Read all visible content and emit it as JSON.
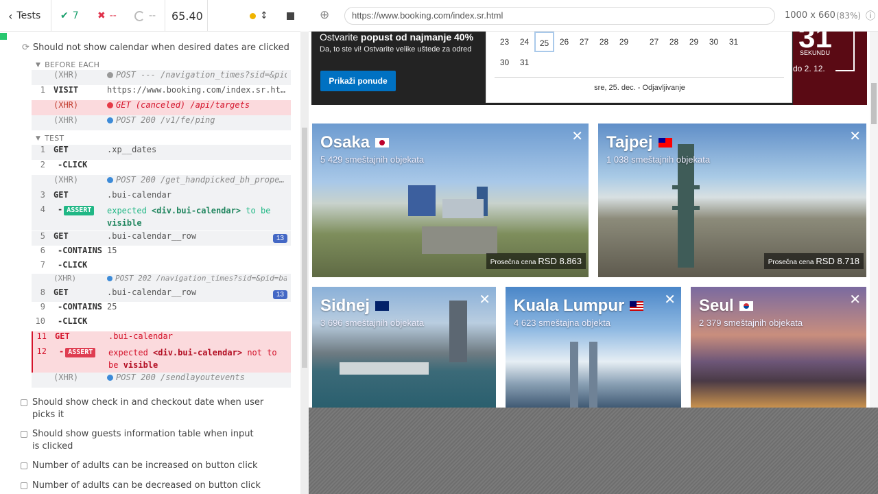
{
  "reporter": {
    "tests_label": "Tests",
    "passed": "7",
    "failed": "--",
    "pending": "--",
    "duration": "65.40",
    "suite_title": "Should not show calendar when desired dates are clicked",
    "before_each_label": "BEFORE EACH",
    "test_label": "TEST",
    "before_each": [
      {
        "num": "",
        "name": "(XHR)",
        "msg": "POST --- /navigation_times?sid=&pid=668…",
        "dot": "#999999",
        "type": "xhr"
      },
      {
        "num": "1",
        "name": "VISIT",
        "msg": "https://www.booking.com/index.sr.ht…",
        "type": "cmd"
      },
      {
        "num": "",
        "name": "(XHR)",
        "msg": "GET (canceled) /api/targets",
        "dot": "#e63946",
        "type": "xhr-err"
      },
      {
        "num": "",
        "name": "(XHR)",
        "msg": "POST 200 /v1/fe/ping",
        "dot": "#3d8bd8",
        "type": "xhr"
      }
    ],
    "test_cmds": [
      {
        "num": "1",
        "name": "GET",
        "msg": ".xp__dates"
      },
      {
        "num": "2",
        "name": "-CLICK",
        "msg": ""
      },
      {
        "num": "",
        "name": "(XHR)",
        "msg": "POST 200 /get_handpicked_bh_prope…",
        "dot": "#3d8bd8"
      },
      {
        "num": "3",
        "name": "GET",
        "msg": ".bui-calendar"
      },
      {
        "num": "4",
        "name": "-ASSERT",
        "expected": "expected",
        "el": "<div.bui-calendar>",
        "to_be": "to be",
        "state": "visible"
      },
      {
        "num": "5",
        "name": "GET",
        "msg": ".bui-calendar__row",
        "badge": "13"
      },
      {
        "num": "6",
        "name": "-CONTAINS",
        "msg": "15"
      },
      {
        "num": "7",
        "name": "-CLICK",
        "msg": ""
      },
      {
        "num": "",
        "name": "(XHR)",
        "msg": "POST 202 /navigation_times?sid=&pid=bab…",
        "dot": "#3d8bd8"
      },
      {
        "num": "8",
        "name": "GET",
        "msg": ".bui-calendar__row",
        "badge": "13"
      },
      {
        "num": "9",
        "name": "-CONTAINS",
        "msg": "25"
      },
      {
        "num": "10",
        "name": "-CLICK",
        "msg": ""
      },
      {
        "num": "11",
        "name": "GET",
        "msg": ".bui-calendar"
      },
      {
        "num": "12",
        "name": "-ASSERT",
        "expected": "expected",
        "el": "<div.bui-calendar>",
        "not_to": "not to",
        "be": "be",
        "state": "visible"
      },
      {
        "num": "",
        "name": "(XHR)",
        "msg": "POST 200 /sendlayoutevents",
        "dot": "#3d8bd8"
      }
    ],
    "other_tests": [
      "Should show check in and checkout date when user picks it",
      "Should show guests information table when input is clicked",
      "Number of adults can be increased on button click",
      "Number of adults can be decreased on button click"
    ]
  },
  "app": {
    "url": "https://www.booking.com/index.sr.html",
    "viewport_size": "1000 x 660",
    "zoom": "(83%)",
    "banner": {
      "headline_prefix": "Ostvarite",
      "headline_bold": "popust od najmanje 40%",
      "subline": "Da, to ste vi! Ostvarite velike uštede za odred",
      "button": "Prikaži ponude",
      "countdown_number": "31",
      "countdown_label": "SEKUNDU",
      "until": "do 2. 12."
    },
    "calendar": {
      "row1_left": [
        "23",
        "24",
        "25",
        "26",
        "27",
        "28",
        "29"
      ],
      "row1_right": [
        "27",
        "28",
        "29",
        "30",
        "31"
      ],
      "row2_left": [
        "30",
        "31"
      ],
      "selected": "25",
      "footer": "sre, 25. dec. - Odjavljivanje"
    },
    "destinations": [
      {
        "name": "Osaka",
        "count": "5 429 smeštajnih objekata",
        "price_label": "Prosečna cena",
        "price": "RSD 8.863"
      },
      {
        "name": "Tajpej",
        "count": "1 038 smeštajnih objekata",
        "price_label": "Prosečna cena",
        "price": "RSD 8.718"
      },
      {
        "name": "Sidnej",
        "count": "3 696 smeštajnih objekata"
      },
      {
        "name": "Kuala Lumpur",
        "count": "4 623 smeštajna objekta"
      },
      {
        "name": "Seul",
        "count": "2 379 smeštajnih objekata"
      }
    ]
  }
}
